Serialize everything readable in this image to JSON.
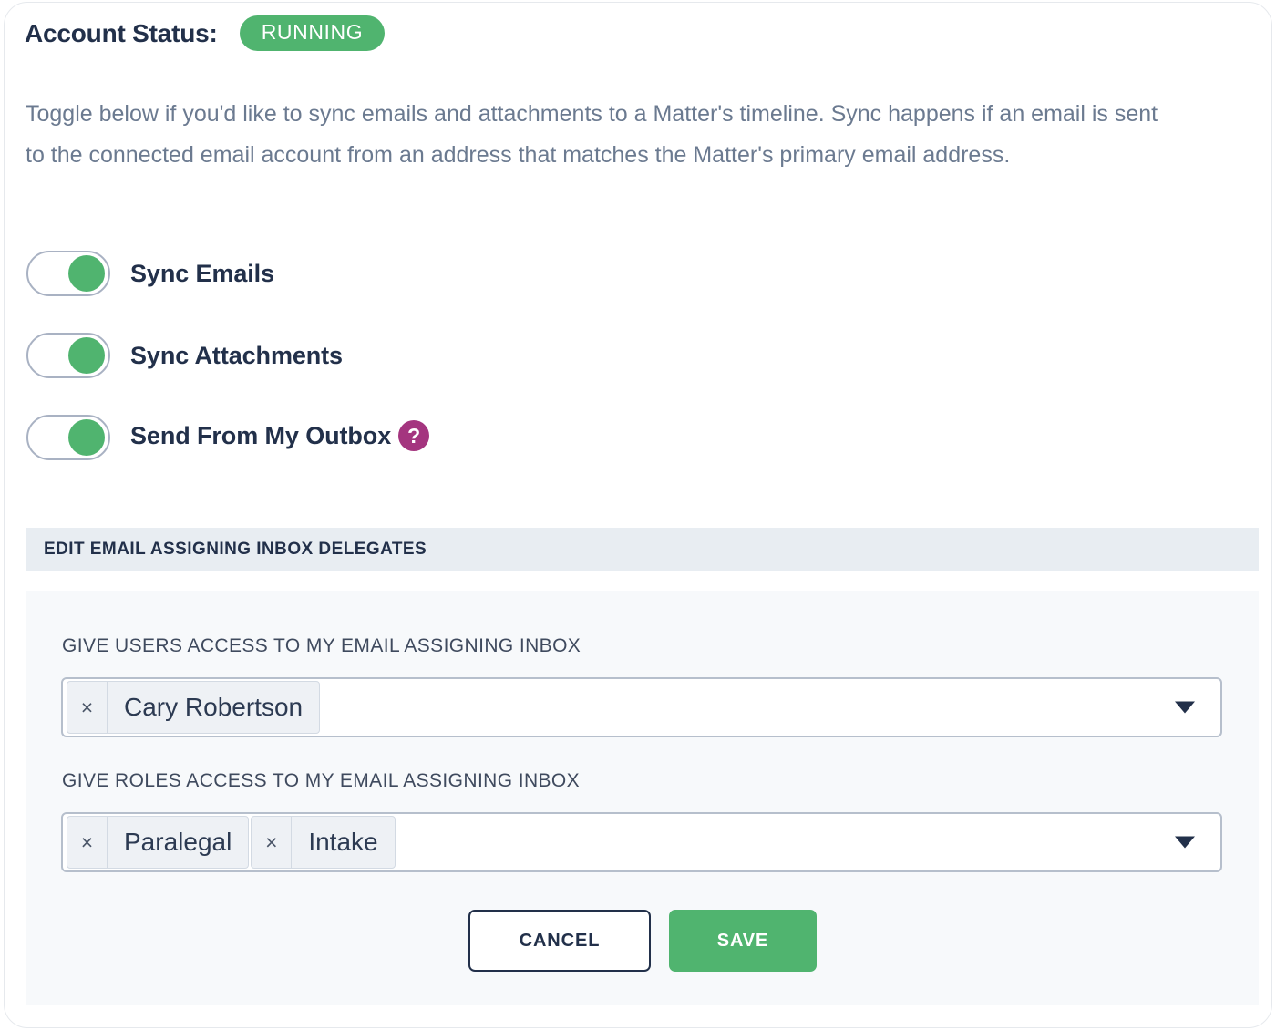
{
  "header": {
    "status_label": "Account Status:",
    "status_value": "RUNNING",
    "status_color": "#50b46f",
    "description": "Toggle below if you'd like to sync emails and attachments to a Matter's timeline. Sync happens if an email is sent to the connected email account from an address that matches the Matter's primary email address."
  },
  "toggles": [
    {
      "label": "Sync Emails",
      "on": true
    },
    {
      "label": "Sync Attachments",
      "on": true
    },
    {
      "label": "Send From My Outbox",
      "on": true,
      "help": "?"
    }
  ],
  "section": {
    "title": "EDIT EMAIL ASSIGNING INBOX DELEGATES",
    "bar_color": "#e8edf2"
  },
  "form": {
    "users_field": {
      "label": "GIVE USERS ACCESS TO MY EMAIL ASSIGNING INBOX",
      "chips": [
        {
          "remove": "×",
          "label": "Cary Robertson"
        }
      ]
    },
    "roles_field": {
      "label": "GIVE ROLES ACCESS TO MY EMAIL ASSIGNING INBOX",
      "chips": [
        {
          "remove": "×",
          "label": "Paralegal"
        },
        {
          "remove": "×",
          "label": "Intake"
        }
      ]
    },
    "buttons": {
      "cancel": "CANCEL",
      "save": "SAVE",
      "save_color": "#50b46f"
    }
  }
}
